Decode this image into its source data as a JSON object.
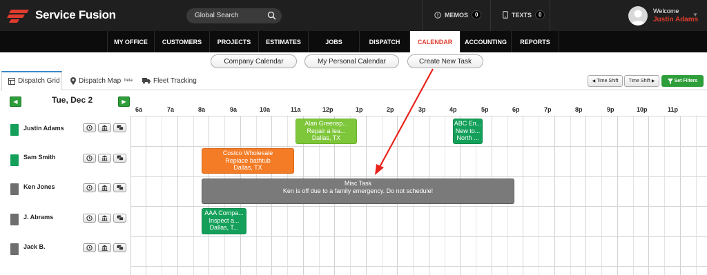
{
  "brand": {
    "name": "Service Fusion",
    "logo_color": "#e03c2e"
  },
  "header": {
    "search_placeholder": "Global Search",
    "memos_label": "MEMOS",
    "memos_count": "0",
    "texts_label": "TEXTS",
    "texts_count": "0",
    "welcome": "Welcome",
    "user_name": "Justin Adams"
  },
  "nav": {
    "items": [
      "MY OFFICE",
      "CUSTOMERS",
      "PROJECTS",
      "ESTIMATES",
      "JOBS",
      "DISPATCH",
      "CALENDAR",
      "ACCOUNTING",
      "REPORTS"
    ],
    "active": "CALENDAR"
  },
  "subnav": {
    "company_calendar": "Company Calendar",
    "personal_calendar": "My Personal Calendar",
    "new_task": "Create New Task"
  },
  "tabs": {
    "dispatch_grid": "Dispatch Grid",
    "dispatch_map": "Dispatch Map",
    "dispatch_map_badge": "beta",
    "fleet_tracking": "Fleet Tracking"
  },
  "toolbar": {
    "time_shift_back": "Time Shift",
    "time_shift_forward": "Time Shift",
    "set_filters": "Set Filters"
  },
  "date_label": "Tue, Dec 2",
  "hours": [
    "6a",
    "7a",
    "8a",
    "9a",
    "10a",
    "11a",
    "12p",
    "1p",
    "2p",
    "3p",
    "4p",
    "5p",
    "6p",
    "7p",
    "8p",
    "9p",
    "10p",
    "11p"
  ],
  "technicians": [
    {
      "name": "Justin Adams",
      "color": "#14a05a"
    },
    {
      "name": "Sam Smith",
      "color": "#14a05a"
    },
    {
      "name": "Ken Jones",
      "color": "#6e6e6e"
    },
    {
      "name": "J. Abrams",
      "color": "#6e6e6e"
    },
    {
      "name": "Jack B.",
      "color": "#6e6e6e"
    }
  ],
  "events": {
    "alan": {
      "line1": "Alan Greensp...",
      "line2": "Repair a lea...",
      "line3": "Dallas, TX"
    },
    "abc": {
      "line1": "ABC En...",
      "line2": "New to...",
      "line3": "North ..."
    },
    "costco": {
      "line1": "Costco Wholesale",
      "line2": "Replace bathtub",
      "line3": "Dallas, TX"
    },
    "misc": {
      "line1": "Misc Task",
      "line2": "Ken is off due to a family emergency. Do not schedule!"
    },
    "aaa": {
      "line1": "AAA Compa...",
      "line2": "Inspect a...",
      "line3": "Dallas, T..."
    }
  },
  "colors": {
    "accent_red": "#e03c2e",
    "green": "#14a05a",
    "lime": "#7ec63a",
    "orange": "#f47c27",
    "gray": "#7a7a7a"
  }
}
